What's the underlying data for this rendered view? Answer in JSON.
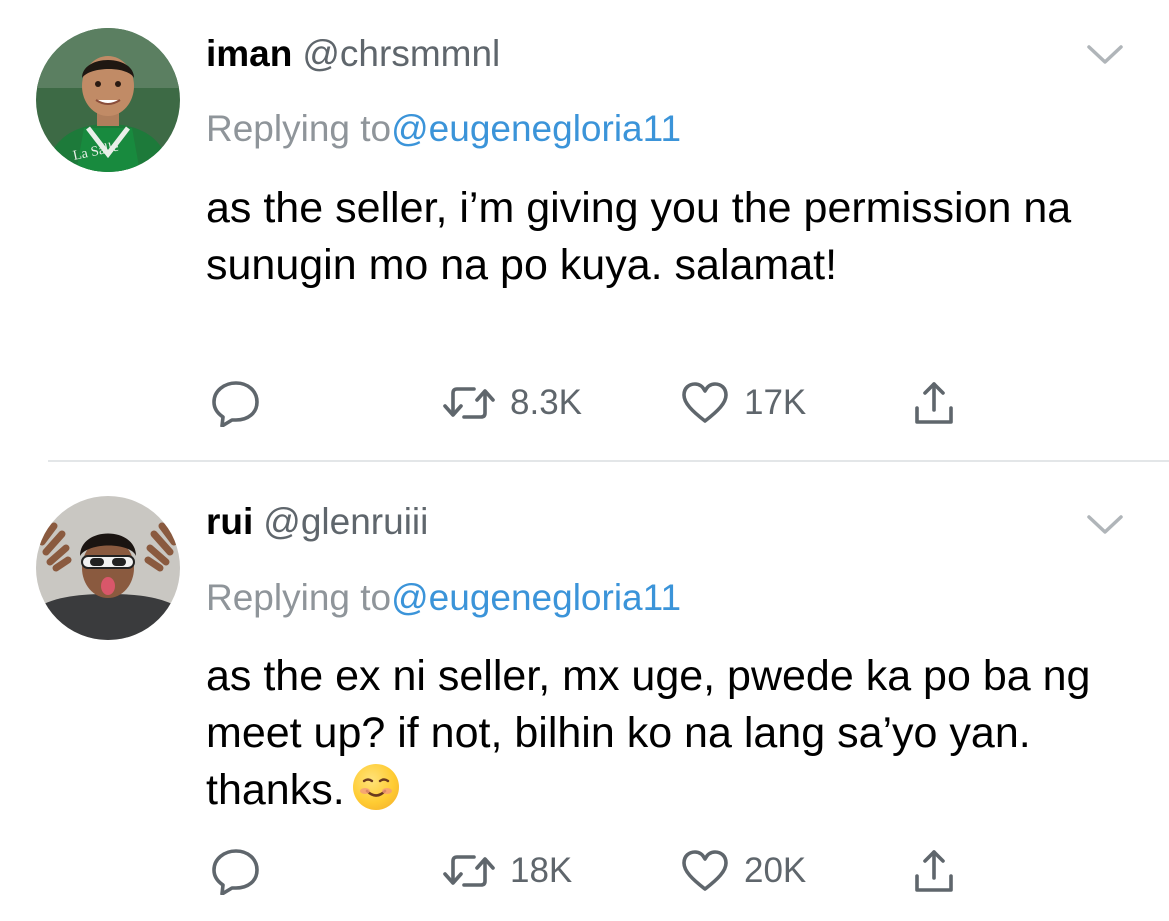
{
  "tweets": [
    {
      "display_name": "iman",
      "handle": "@chrsmmnl",
      "replying_prefix": "Replying to",
      "replying_handle": "@eugenegloria11",
      "text": "as the seller, i’m giving you the permission na sunugin mo na po kuya. salamat!",
      "retweets": "8.3K",
      "likes": "17K",
      "avatar_icon": "person-avatar-green-jersey"
    },
    {
      "display_name": "rui",
      "handle": "@glenruiii",
      "replying_prefix": "Replying to",
      "replying_handle": "@eugenegloria11",
      "text": "as the ex ni seller, mx uge, pwede ka po ba ng meet up? if not, bilhin ko na lang sa’yo yan. thanks.",
      "emoji": "smiling-face-emoji",
      "retweets": "18K",
      "likes": "20K",
      "avatar_icon": "person-avatar-sunglasses"
    }
  ],
  "colors": {
    "name": "#000000",
    "secondary": "#5f666c",
    "muted": "#8f959a",
    "link": "#3b94d9",
    "divider": "#e3e6e8"
  }
}
